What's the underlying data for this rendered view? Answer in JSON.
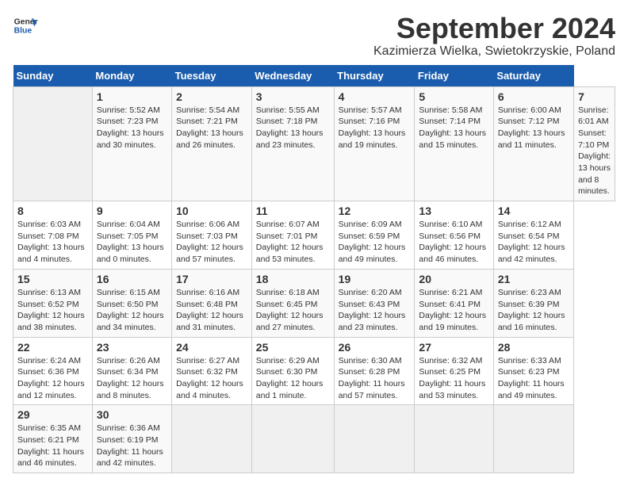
{
  "header": {
    "logo_line1": "General",
    "logo_line2": "Blue",
    "title": "September 2024",
    "subtitle": "Kazimierza Wielka, Swietokrzyskie, Poland"
  },
  "calendar": {
    "days_of_week": [
      "Sunday",
      "Monday",
      "Tuesday",
      "Wednesday",
      "Thursday",
      "Friday",
      "Saturday"
    ],
    "weeks": [
      [
        {
          "day": "",
          "info": ""
        },
        {
          "day": "1",
          "info": "Sunrise: 5:52 AM\nSunset: 7:23 PM\nDaylight: 13 hours\nand 30 minutes."
        },
        {
          "day": "2",
          "info": "Sunrise: 5:54 AM\nSunset: 7:21 PM\nDaylight: 13 hours\nand 26 minutes."
        },
        {
          "day": "3",
          "info": "Sunrise: 5:55 AM\nSunset: 7:18 PM\nDaylight: 13 hours\nand 23 minutes."
        },
        {
          "day": "4",
          "info": "Sunrise: 5:57 AM\nSunset: 7:16 PM\nDaylight: 13 hours\nand 19 minutes."
        },
        {
          "day": "5",
          "info": "Sunrise: 5:58 AM\nSunset: 7:14 PM\nDaylight: 13 hours\nand 15 minutes."
        },
        {
          "day": "6",
          "info": "Sunrise: 6:00 AM\nSunset: 7:12 PM\nDaylight: 13 hours\nand 11 minutes."
        },
        {
          "day": "7",
          "info": "Sunrise: 6:01 AM\nSunset: 7:10 PM\nDaylight: 13 hours\nand 8 minutes."
        }
      ],
      [
        {
          "day": "8",
          "info": "Sunrise: 6:03 AM\nSunset: 7:08 PM\nDaylight: 13 hours\nand 4 minutes."
        },
        {
          "day": "9",
          "info": "Sunrise: 6:04 AM\nSunset: 7:05 PM\nDaylight: 13 hours\nand 0 minutes."
        },
        {
          "day": "10",
          "info": "Sunrise: 6:06 AM\nSunset: 7:03 PM\nDaylight: 12 hours\nand 57 minutes."
        },
        {
          "day": "11",
          "info": "Sunrise: 6:07 AM\nSunset: 7:01 PM\nDaylight: 12 hours\nand 53 minutes."
        },
        {
          "day": "12",
          "info": "Sunrise: 6:09 AM\nSunset: 6:59 PM\nDaylight: 12 hours\nand 49 minutes."
        },
        {
          "day": "13",
          "info": "Sunrise: 6:10 AM\nSunset: 6:56 PM\nDaylight: 12 hours\nand 46 minutes."
        },
        {
          "day": "14",
          "info": "Sunrise: 6:12 AM\nSunset: 6:54 PM\nDaylight: 12 hours\nand 42 minutes."
        }
      ],
      [
        {
          "day": "15",
          "info": "Sunrise: 6:13 AM\nSunset: 6:52 PM\nDaylight: 12 hours\nand 38 minutes."
        },
        {
          "day": "16",
          "info": "Sunrise: 6:15 AM\nSunset: 6:50 PM\nDaylight: 12 hours\nand 34 minutes."
        },
        {
          "day": "17",
          "info": "Sunrise: 6:16 AM\nSunset: 6:48 PM\nDaylight: 12 hours\nand 31 minutes."
        },
        {
          "day": "18",
          "info": "Sunrise: 6:18 AM\nSunset: 6:45 PM\nDaylight: 12 hours\nand 27 minutes."
        },
        {
          "day": "19",
          "info": "Sunrise: 6:20 AM\nSunset: 6:43 PM\nDaylight: 12 hours\nand 23 minutes."
        },
        {
          "day": "20",
          "info": "Sunrise: 6:21 AM\nSunset: 6:41 PM\nDaylight: 12 hours\nand 19 minutes."
        },
        {
          "day": "21",
          "info": "Sunrise: 6:23 AM\nSunset: 6:39 PM\nDaylight: 12 hours\nand 16 minutes."
        }
      ],
      [
        {
          "day": "22",
          "info": "Sunrise: 6:24 AM\nSunset: 6:36 PM\nDaylight: 12 hours\nand 12 minutes."
        },
        {
          "day": "23",
          "info": "Sunrise: 6:26 AM\nSunset: 6:34 PM\nDaylight: 12 hours\nand 8 minutes."
        },
        {
          "day": "24",
          "info": "Sunrise: 6:27 AM\nSunset: 6:32 PM\nDaylight: 12 hours\nand 4 minutes."
        },
        {
          "day": "25",
          "info": "Sunrise: 6:29 AM\nSunset: 6:30 PM\nDaylight: 12 hours\nand 1 minute."
        },
        {
          "day": "26",
          "info": "Sunrise: 6:30 AM\nSunset: 6:28 PM\nDaylight: 11 hours\nand 57 minutes."
        },
        {
          "day": "27",
          "info": "Sunrise: 6:32 AM\nSunset: 6:25 PM\nDaylight: 11 hours\nand 53 minutes."
        },
        {
          "day": "28",
          "info": "Sunrise: 6:33 AM\nSunset: 6:23 PM\nDaylight: 11 hours\nand 49 minutes."
        }
      ],
      [
        {
          "day": "29",
          "info": "Sunrise: 6:35 AM\nSunset: 6:21 PM\nDaylight: 11 hours\nand 46 minutes."
        },
        {
          "day": "30",
          "info": "Sunrise: 6:36 AM\nSunset: 6:19 PM\nDaylight: 11 hours\nand 42 minutes."
        },
        {
          "day": "",
          "info": ""
        },
        {
          "day": "",
          "info": ""
        },
        {
          "day": "",
          "info": ""
        },
        {
          "day": "",
          "info": ""
        },
        {
          "day": "",
          "info": ""
        }
      ]
    ]
  }
}
